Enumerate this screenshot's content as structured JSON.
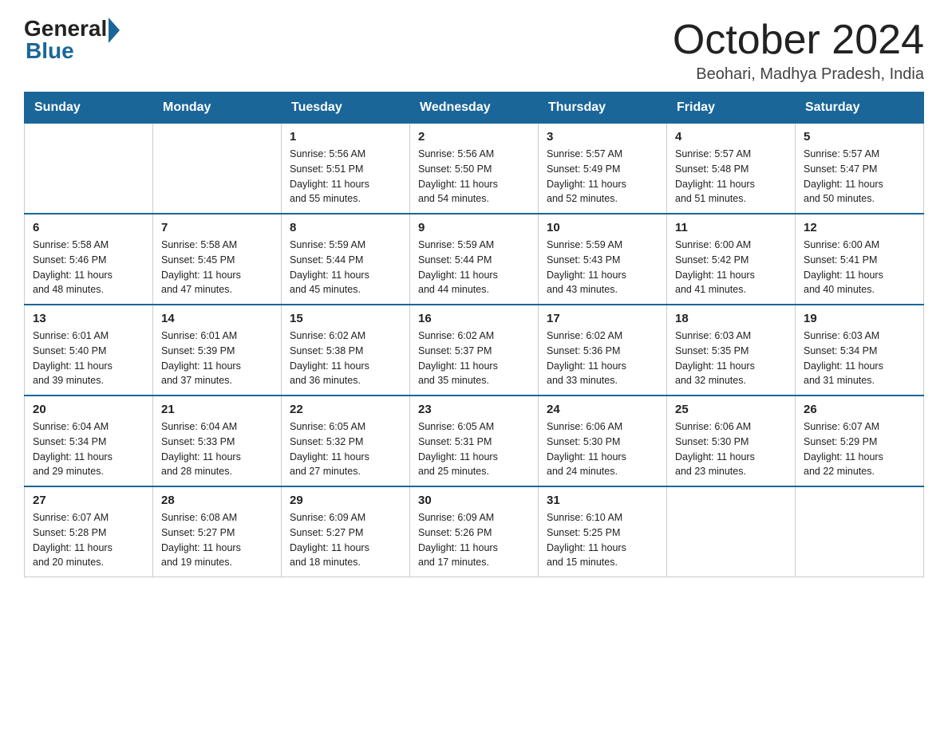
{
  "logo": {
    "general": "General",
    "blue": "Blue"
  },
  "header": {
    "month": "October 2024",
    "location": "Beohari, Madhya Pradesh, India"
  },
  "days_of_week": [
    "Sunday",
    "Monday",
    "Tuesday",
    "Wednesday",
    "Thursday",
    "Friday",
    "Saturday"
  ],
  "weeks": [
    [
      {
        "day": "",
        "info": ""
      },
      {
        "day": "",
        "info": ""
      },
      {
        "day": "1",
        "info": "Sunrise: 5:56 AM\nSunset: 5:51 PM\nDaylight: 11 hours\nand 55 minutes."
      },
      {
        "day": "2",
        "info": "Sunrise: 5:56 AM\nSunset: 5:50 PM\nDaylight: 11 hours\nand 54 minutes."
      },
      {
        "day": "3",
        "info": "Sunrise: 5:57 AM\nSunset: 5:49 PM\nDaylight: 11 hours\nand 52 minutes."
      },
      {
        "day": "4",
        "info": "Sunrise: 5:57 AM\nSunset: 5:48 PM\nDaylight: 11 hours\nand 51 minutes."
      },
      {
        "day": "5",
        "info": "Sunrise: 5:57 AM\nSunset: 5:47 PM\nDaylight: 11 hours\nand 50 minutes."
      }
    ],
    [
      {
        "day": "6",
        "info": "Sunrise: 5:58 AM\nSunset: 5:46 PM\nDaylight: 11 hours\nand 48 minutes."
      },
      {
        "day": "7",
        "info": "Sunrise: 5:58 AM\nSunset: 5:45 PM\nDaylight: 11 hours\nand 47 minutes."
      },
      {
        "day": "8",
        "info": "Sunrise: 5:59 AM\nSunset: 5:44 PM\nDaylight: 11 hours\nand 45 minutes."
      },
      {
        "day": "9",
        "info": "Sunrise: 5:59 AM\nSunset: 5:44 PM\nDaylight: 11 hours\nand 44 minutes."
      },
      {
        "day": "10",
        "info": "Sunrise: 5:59 AM\nSunset: 5:43 PM\nDaylight: 11 hours\nand 43 minutes."
      },
      {
        "day": "11",
        "info": "Sunrise: 6:00 AM\nSunset: 5:42 PM\nDaylight: 11 hours\nand 41 minutes."
      },
      {
        "day": "12",
        "info": "Sunrise: 6:00 AM\nSunset: 5:41 PM\nDaylight: 11 hours\nand 40 minutes."
      }
    ],
    [
      {
        "day": "13",
        "info": "Sunrise: 6:01 AM\nSunset: 5:40 PM\nDaylight: 11 hours\nand 39 minutes."
      },
      {
        "day": "14",
        "info": "Sunrise: 6:01 AM\nSunset: 5:39 PM\nDaylight: 11 hours\nand 37 minutes."
      },
      {
        "day": "15",
        "info": "Sunrise: 6:02 AM\nSunset: 5:38 PM\nDaylight: 11 hours\nand 36 minutes."
      },
      {
        "day": "16",
        "info": "Sunrise: 6:02 AM\nSunset: 5:37 PM\nDaylight: 11 hours\nand 35 minutes."
      },
      {
        "day": "17",
        "info": "Sunrise: 6:02 AM\nSunset: 5:36 PM\nDaylight: 11 hours\nand 33 minutes."
      },
      {
        "day": "18",
        "info": "Sunrise: 6:03 AM\nSunset: 5:35 PM\nDaylight: 11 hours\nand 32 minutes."
      },
      {
        "day": "19",
        "info": "Sunrise: 6:03 AM\nSunset: 5:34 PM\nDaylight: 11 hours\nand 31 minutes."
      }
    ],
    [
      {
        "day": "20",
        "info": "Sunrise: 6:04 AM\nSunset: 5:34 PM\nDaylight: 11 hours\nand 29 minutes."
      },
      {
        "day": "21",
        "info": "Sunrise: 6:04 AM\nSunset: 5:33 PM\nDaylight: 11 hours\nand 28 minutes."
      },
      {
        "day": "22",
        "info": "Sunrise: 6:05 AM\nSunset: 5:32 PM\nDaylight: 11 hours\nand 27 minutes."
      },
      {
        "day": "23",
        "info": "Sunrise: 6:05 AM\nSunset: 5:31 PM\nDaylight: 11 hours\nand 25 minutes."
      },
      {
        "day": "24",
        "info": "Sunrise: 6:06 AM\nSunset: 5:30 PM\nDaylight: 11 hours\nand 24 minutes."
      },
      {
        "day": "25",
        "info": "Sunrise: 6:06 AM\nSunset: 5:30 PM\nDaylight: 11 hours\nand 23 minutes."
      },
      {
        "day": "26",
        "info": "Sunrise: 6:07 AM\nSunset: 5:29 PM\nDaylight: 11 hours\nand 22 minutes."
      }
    ],
    [
      {
        "day": "27",
        "info": "Sunrise: 6:07 AM\nSunset: 5:28 PM\nDaylight: 11 hours\nand 20 minutes."
      },
      {
        "day": "28",
        "info": "Sunrise: 6:08 AM\nSunset: 5:27 PM\nDaylight: 11 hours\nand 19 minutes."
      },
      {
        "day": "29",
        "info": "Sunrise: 6:09 AM\nSunset: 5:27 PM\nDaylight: 11 hours\nand 18 minutes."
      },
      {
        "day": "30",
        "info": "Sunrise: 6:09 AM\nSunset: 5:26 PM\nDaylight: 11 hours\nand 17 minutes."
      },
      {
        "day": "31",
        "info": "Sunrise: 6:10 AM\nSunset: 5:25 PM\nDaylight: 11 hours\nand 15 minutes."
      },
      {
        "day": "",
        "info": ""
      },
      {
        "day": "",
        "info": ""
      }
    ]
  ]
}
